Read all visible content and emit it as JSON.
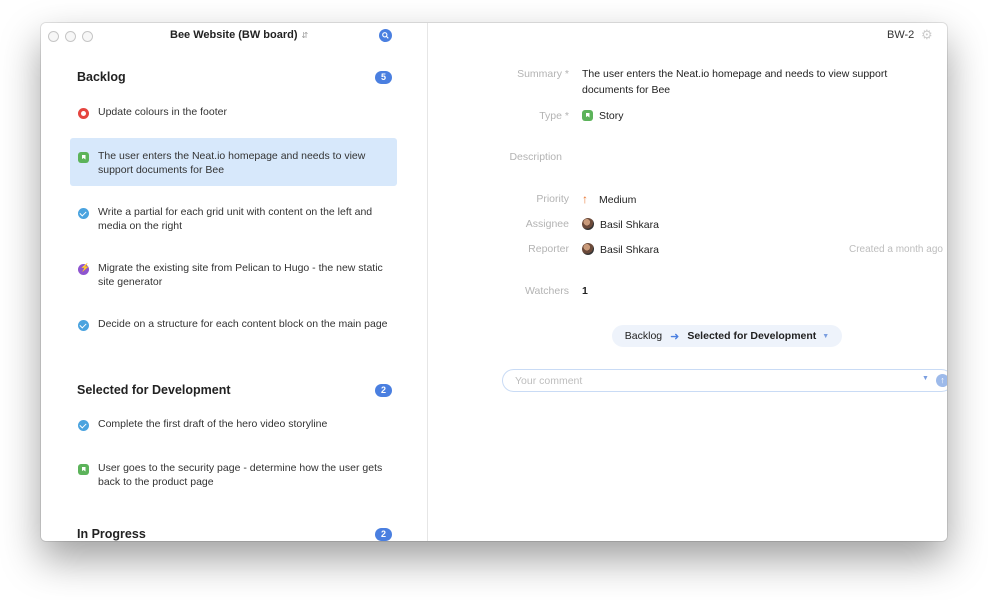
{
  "board": {
    "title": "Bee Website (BW board)"
  },
  "sections": [
    {
      "title": "Backlog",
      "count": "5"
    },
    {
      "title": "Selected for Development",
      "count": "2"
    },
    {
      "title": "In Progress",
      "count": "2"
    }
  ],
  "tasks": [
    {
      "type": "bug",
      "text": "Update colours in the footer"
    },
    {
      "type": "story",
      "text": "The user enters the Neat.io homepage and needs to view support documents for Bee",
      "selected": true
    },
    {
      "type": "task",
      "text": "Write a partial for each grid unit with content on the left and media on the right"
    },
    {
      "type": "epic",
      "text": "Migrate the existing site from Pelican to Hugo - the new static site generator"
    },
    {
      "type": "task",
      "text": "Decide on a structure for each content block on the main page"
    },
    {
      "type": "task",
      "text": "Complete the first draft of the hero video storyline"
    },
    {
      "type": "story",
      "text": "User goes to the security page - determine how the user gets back to the product page"
    }
  ],
  "issue": {
    "key": "BW-2",
    "labels": {
      "summary": "Summary *",
      "type": "Type *",
      "description": "Description",
      "priority": "Priority",
      "assignee": "Assignee",
      "reporter": "Reporter",
      "watchers": "Watchers"
    },
    "summary": "The user enters the Neat.io homepage and needs to view support documents for Bee",
    "type": "Story",
    "priority": "Medium",
    "assignee": "Basil Shkara",
    "reporter": "Basil Shkara",
    "created": "Created a month ago",
    "watchers": "1",
    "transition": {
      "from": "Backlog",
      "to": "Selected for Development"
    },
    "comment_placeholder": "Your comment"
  },
  "icons": {
    "bug": "bug-icon",
    "story": "story-icon",
    "task": "task-check-icon",
    "epic": "epic-lightning-icon",
    "search": "search-icon",
    "gear": "gear-icon",
    "priority": "arrow-up-icon",
    "send": "send-icon"
  },
  "colors": {
    "accent": "#4a7fe0",
    "selected_row": "#d7e8fb",
    "bug": "#e5453f",
    "story": "#5cb35a",
    "task": "#4aa3df",
    "epic": "#8e55cf",
    "priority": "#e8742e"
  }
}
